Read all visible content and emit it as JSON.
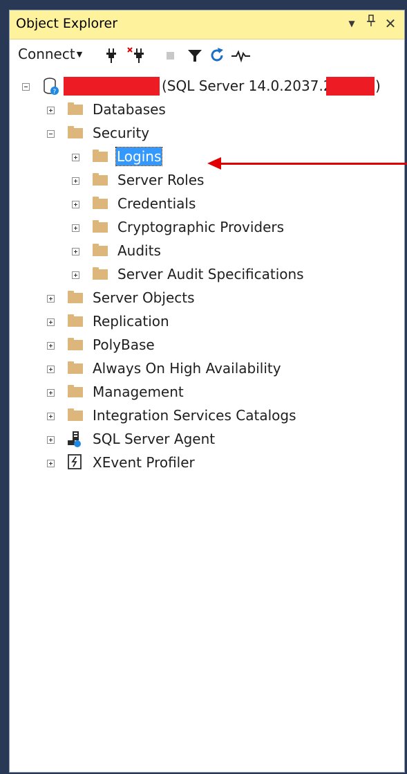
{
  "window": {
    "title": "Object Explorer",
    "dropdown_icon": "chevron-down-icon",
    "pin_icon": "pin-icon",
    "close_icon": "close-icon"
  },
  "toolbar": {
    "connect_label": "Connect",
    "items": [
      "connect-icon",
      "disconnect-icon",
      "stop-icon",
      "filter-icon",
      "refresh-icon",
      "activity-monitor-icon"
    ]
  },
  "tree": {
    "server_label": "(SQL Server 14.0.2037.2 -",
    "server_label_suffix": ")",
    "databases": "Databases",
    "security": "Security",
    "logins": "Logins",
    "server_roles": "Server Roles",
    "credentials": "Credentials",
    "cryptographic_providers": "Cryptographic Providers",
    "audits": "Audits",
    "server_audit_specifications": "Server Audit Specifications",
    "server_objects": "Server Objects",
    "replication": "Replication",
    "polybase": "PolyBase",
    "always_on": "Always On High Availability",
    "management": "Management",
    "integration_services": "Integration Services Catalogs",
    "sql_server_agent": "SQL Server Agent",
    "xevent_profiler": "XEvent Profiler"
  },
  "colors": {
    "title_bar": "#fff29d",
    "selection": "#3399ff",
    "folder": "#dcb67a",
    "annotation_red": "#e00000",
    "frame": "#293955"
  }
}
